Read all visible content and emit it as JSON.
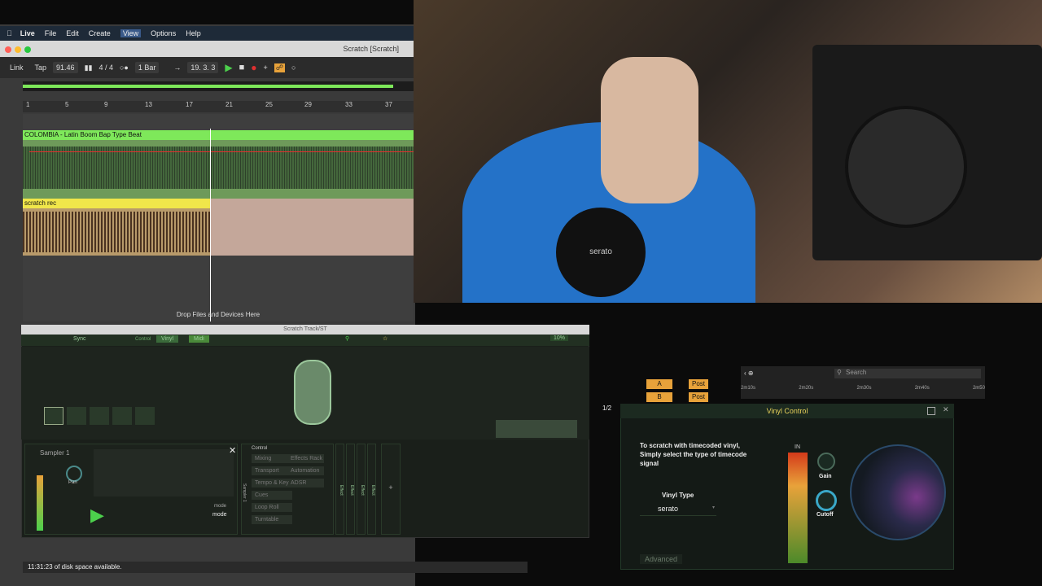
{
  "menubar": {
    "items": [
      "Live",
      "File",
      "Edit",
      "Create",
      "View",
      "Options",
      "Help"
    ]
  },
  "window": {
    "title": "Scratch  [Scratch]"
  },
  "transport": {
    "link": "Link",
    "tap": "Tap",
    "tempo": "91.46",
    "signature": "4 / 4",
    "quantize": "1 Bar",
    "position": "19.  3.  3"
  },
  "ruler": {
    "marks": [
      "1",
      "5",
      "9",
      "13",
      "17",
      "21",
      "25",
      "29",
      "33",
      "37"
    ]
  },
  "tracks": [
    {
      "name": "COLOMBIA - Latin Boom Bap Type Beat",
      "color": "#7ee85a"
    },
    {
      "name": "scratch rec",
      "color": "#f0e64a"
    }
  ],
  "drop_hint": "Drop Files and Devices Here",
  "plugin": {
    "title": "Scratch Track/ST",
    "sync": "Sync",
    "control": "Control",
    "vinyl_btn": "Vinyl",
    "midi_btn": "Midi",
    "percent": "10%",
    "sampler": "Sampler 1",
    "pan": "Pan",
    "mode1": "mode",
    "mode2": "mode",
    "control_list": [
      "Mixing",
      "Transport",
      "Tempo & Key",
      "Cues",
      "Loop Roll",
      "Turntable"
    ],
    "control_list2": [
      "Effects Rack",
      "Automation",
      "ADSR"
    ],
    "effect_label": "Effect",
    "side_label": "Sampler 1"
  },
  "status": "11:31:23 of disk space available.",
  "right": {
    "search_placeholder": "Search",
    "times": [
      "2m10s",
      "2m20s",
      "2m30s",
      "2m40s",
      "2m50"
    ],
    "labelA": "A",
    "labelB": "B",
    "post": "Post",
    "ratio": "1/2"
  },
  "vinyl_control": {
    "title": "Vinyl Control",
    "instruction": "To scratch with timecoded vinyl, Simply select the type of timecode signal",
    "vinyl_type_label": "Vinyl Type",
    "vinyl_type_value": "serato",
    "in_label": "IN",
    "gain": "Gain",
    "cutoff": "Cutoff",
    "advanced": "Advanced"
  }
}
